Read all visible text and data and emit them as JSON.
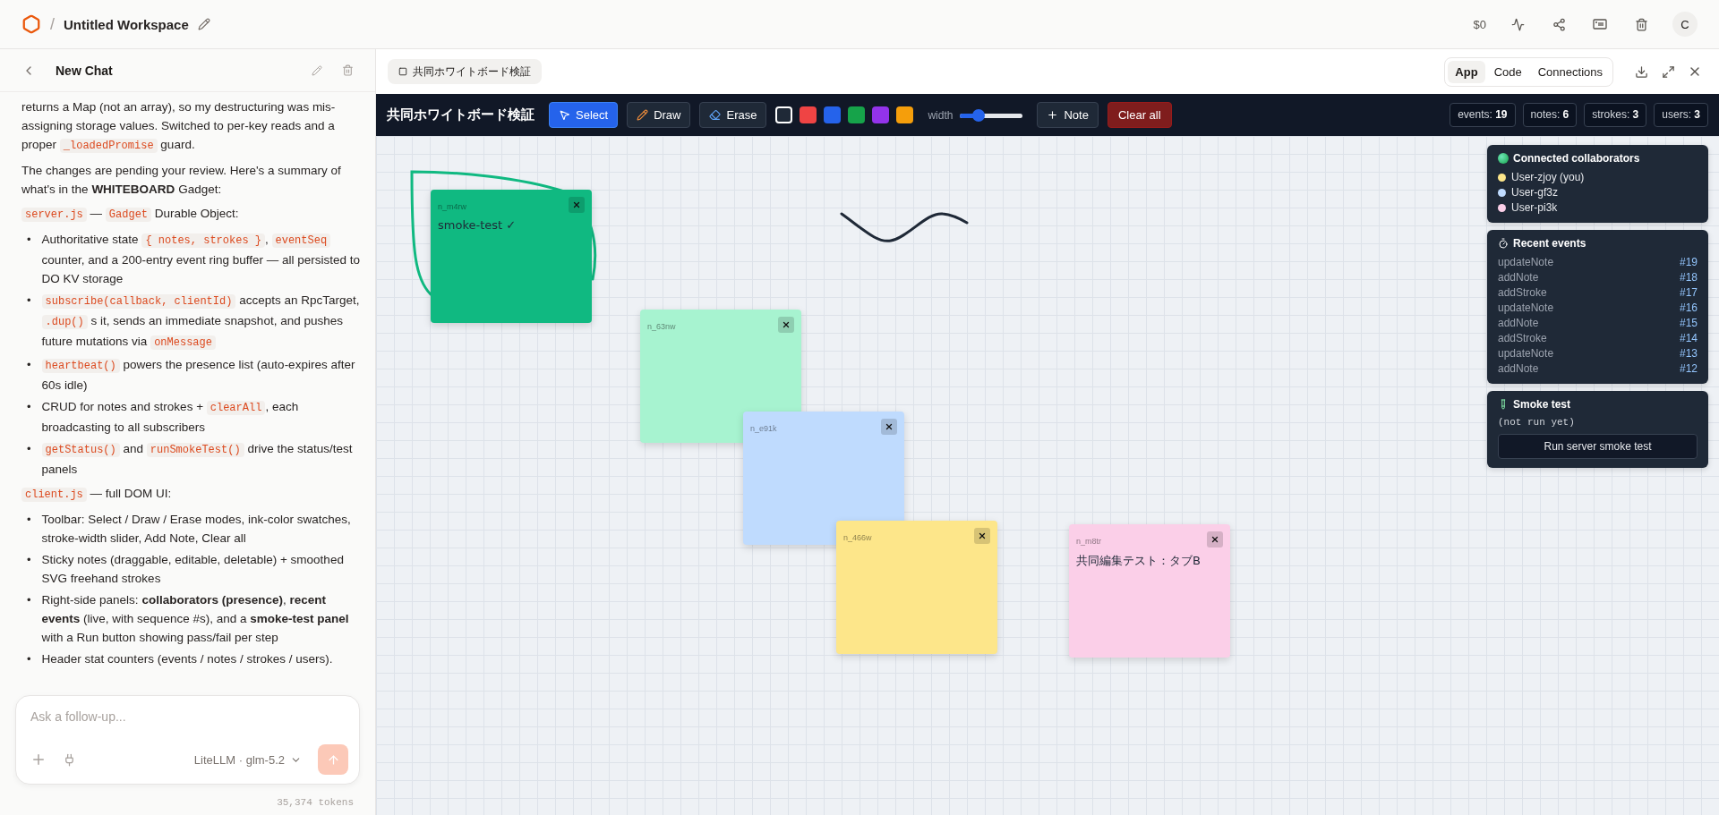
{
  "header": {
    "separator": "/",
    "workspace": "Untitled Workspace",
    "cost": "$0",
    "avatar": "C"
  },
  "chat": {
    "title": "New Chat",
    "blocks": [
      {
        "kind": "paragraph",
        "segments": [
          {
            "kind": "text",
            "text": "returns a Map (not an array), so my destructuring was mis-assigning storage values. Switched to per-key reads and a proper "
          },
          {
            "kind": "code",
            "text": "_loadedPromise"
          },
          {
            "kind": "text",
            "text": " guard."
          }
        ]
      },
      {
        "kind": "paragraph",
        "segments": [
          {
            "kind": "text",
            "text": "The changes are pending your review. Here's a summary of what's in the **WHITEBOARD** Gadget:"
          }
        ]
      },
      {
        "kind": "paragraph",
        "segments": [
          {
            "kind": "code",
            "text": "server.js"
          },
          {
            "kind": "text",
            "text": " — "
          },
          {
            "kind": "code",
            "text": "Gadget"
          },
          {
            "kind": "text",
            "text": " Durable Object:"
          }
        ]
      },
      {
        "kind": "list",
        "marker": "•",
        "items": [
          [
            {
              "kind": "text",
              "text": "Authoritative state "
            },
            {
              "kind": "code",
              "text": "{ notes, strokes }"
            },
            {
              "kind": "text",
              "text": ", "
            },
            {
              "kind": "code",
              "text": "eventSeq"
            },
            {
              "kind": "text",
              "text": " counter, and a 200-entry event ring buffer — all persisted to DO KV storage"
            }
          ],
          [
            {
              "kind": "code",
              "text": "subscribe(callback, clientId)"
            },
            {
              "kind": "text",
              "text": " accepts an RpcTarget, "
            },
            {
              "kind": "code",
              "text": ".dup()"
            },
            {
              "kind": "text",
              "text": " s it, sends an immediate snapshot, and pushes future mutations via "
            },
            {
              "kind": "code",
              "text": "onMessage"
            }
          ],
          [
            {
              "kind": "code",
              "text": "heartbeat()"
            },
            {
              "kind": "text",
              "text": " powers the presence list (auto-expires after 60s idle)"
            }
          ],
          [
            {
              "kind": "text",
              "text": "CRUD for notes and strokes + "
            },
            {
              "kind": "code",
              "text": "clearAll"
            },
            {
              "kind": "text",
              "text": ", each broadcasting to all subscribers"
            }
          ],
          [
            {
              "kind": "code",
              "text": "getStatus()"
            },
            {
              "kind": "text",
              "text": " and "
            },
            {
              "kind": "code",
              "text": "runSmokeTest()"
            },
            {
              "kind": "text",
              "text": " drive the status/test panels"
            }
          ]
        ]
      },
      {
        "kind": "paragraph",
        "segments": [
          {
            "kind": "code",
            "text": "client.js"
          },
          {
            "kind": "text",
            "text": " — full DOM UI:"
          }
        ]
      },
      {
        "kind": "list",
        "marker": "•",
        "items": [
          [
            {
              "kind": "text",
              "text": "Toolbar: Select / Draw / Erase modes, ink-color swatches, stroke-width slider, Add Note, Clear all"
            }
          ],
          [
            {
              "kind": "text",
              "text": "Sticky notes (draggable, editable, deletable) + smoothed SVG freehand strokes"
            }
          ],
          [
            {
              "kind": "text",
              "text": "Right-side panels: **collaborators (presence)**, **recent events** (live, with sequence #s), and a **smoke-test panel** with a Run button showing pass/fail per step"
            }
          ],
          [
            {
              "kind": "text",
              "text": "Header stat counters (events / notes / strokes / users)."
            }
          ]
        ]
      }
    ],
    "input": {
      "placeholder": "Ask a follow-up..."
    },
    "model": "LiteLLM · glm-5.2",
    "tokens": "35,374 tokens"
  },
  "preview": {
    "tab": "共同ホワイトボード検証",
    "views": [
      {
        "label": "App",
        "selected": true
      },
      {
        "label": "Code",
        "selected": false
      },
      {
        "label": "Connections",
        "selected": false
      }
    ]
  },
  "toolbar": {
    "title": "共同ホワイトボード検証",
    "modes": [
      {
        "kind": "select",
        "label": "Select",
        "selected": true
      },
      {
        "kind": "draw",
        "label": "Draw",
        "selected": false
      },
      {
        "kind": "erase",
        "label": "Erase",
        "selected": false
      }
    ],
    "swatches": [
      {
        "color": "#1f2937",
        "selected": true
      },
      {
        "color": "#ef4444",
        "selected": false
      },
      {
        "color": "#2563eb",
        "selected": false
      },
      {
        "color": "#16a34a",
        "selected": false
      },
      {
        "color": "#9333ea",
        "selected": false
      },
      {
        "color": "#f59e0b",
        "selected": false
      }
    ],
    "width_label": "width",
    "width": {
      "level": 0.25
    },
    "add_note": "Note",
    "clear": "Clear all",
    "stats": [
      "events: **19**",
      "notes: **6**",
      "strokes: **3**",
      "users: **3**"
    ]
  },
  "notes": [
    {
      "id": "n_m4rw",
      "text": "smoke-test ✓",
      "color": "#10b981"
    },
    {
      "id": "n_63nw",
      "color": "#a7f3d0"
    },
    {
      "id": "n_e91k",
      "color": "#bfdbfe"
    },
    {
      "id": "n_466w",
      "color": "#fde68a"
    },
    {
      "id": "n_m8tr",
      "text": "共同編集テスト：タブB",
      "color": "#fbcfe8"
    }
  ],
  "collaborators": {
    "title": "Connected collaborators",
    "users": [
      {
        "name": "User-zjoy (you)",
        "color": "#fde68a"
      },
      {
        "name": "User-gf3z",
        "color": "#bfdbfe"
      },
      {
        "name": "User-pi3k",
        "color": "#fbcfe8"
      }
    ]
  },
  "events": {
    "title": "Recent events",
    "items": [
      {
        "name": "updateNote",
        "seq": "#19"
      },
      {
        "name": "addNote",
        "seq": "#18"
      },
      {
        "name": "addStroke",
        "seq": "#17"
      },
      {
        "name": "updateNote",
        "seq": "#16"
      },
      {
        "name": "addNote",
        "seq": "#15"
      },
      {
        "name": "addStroke",
        "seq": "#14"
      },
      {
        "name": "updateNote",
        "seq": "#13"
      },
      {
        "name": "addNote",
        "seq": "#12"
      }
    ]
  },
  "smoke": {
    "title": "Smoke test",
    "status": "(not run yet)",
    "button": "Run server smoke test"
  }
}
